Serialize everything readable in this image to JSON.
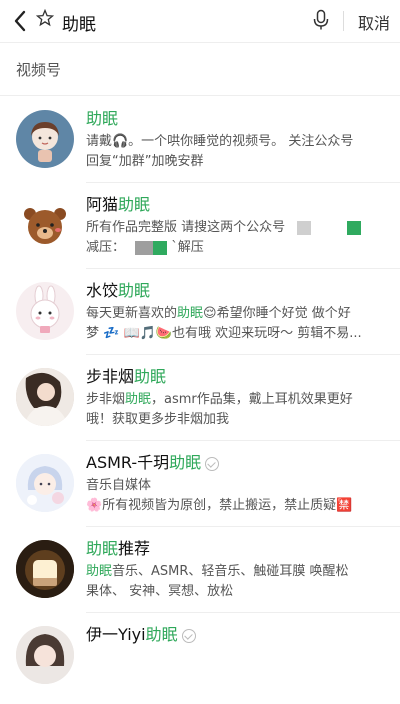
{
  "search": {
    "query": "助眠",
    "cancel_label": "取消"
  },
  "section": {
    "title": "视频号"
  },
  "results": [
    {
      "title_plain": "",
      "title_kw": "助眠",
      "desc1": "请戴🎧。一个哄你睡觉的视频号。 关注公众号",
      "desc2": "回复“加群”加晚安群",
      "avatar_bg": "#5f86a6"
    },
    {
      "title_plain": "阿猫",
      "title_kw": "助眠",
      "desc1": "所有作品完整版 请搜这两个公众号",
      "desc2": "减压：",
      "desc2_tail": "`解压",
      "avatar_bg": "#ffffff"
    },
    {
      "title_plain": "水饺",
      "title_kw": "助眠",
      "desc1_a": "每天更新喜欢的",
      "desc1_kw": "助眠",
      "desc1_b": "😌希望你睡个好觉 做个好",
      "desc2": "梦 💤 📖🎵🍉也有哦 欢迎来玩呀～ 剪辑不易...",
      "avatar_bg": "#f7eef0"
    },
    {
      "title_plain": "步非烟",
      "title_kw": "助眠",
      "desc1_a": "步非烟",
      "desc1_kw": "助眠",
      "desc1_b": "，asmr作品集，戴上耳机效果更好",
      "desc2": "哦！获取更多步非烟加我",
      "avatar_bg": "#d9cfc8"
    },
    {
      "title_plain": "ASMR-千玥",
      "title_kw": "助眠",
      "desc1": "音乐自媒体",
      "desc2": "🌸所有视频皆为原创，禁止搬运，禁止质疑🈲",
      "avatar_bg": "#e8eef7"
    },
    {
      "title_plain": "",
      "title_kw": "助眠",
      "title_suffix": "推荐",
      "desc1_kw": "助眠",
      "desc1_b": "音乐、ASMR、轻音乐、触碰耳膜 唤醒松",
      "desc2": "果体、 安神、冥想、放松",
      "avatar_bg": "#3b2a1c"
    },
    {
      "title_plain": "伊一Yiyi",
      "title_kw": "助眠",
      "avatar_bg": "#ece7e4"
    }
  ],
  "icons": {
    "back": "back-arrow-icon",
    "star": "star-icon",
    "mic": "microphone-icon",
    "verified": "verified-icon"
  },
  "colors": {
    "keyword_green": "#2fa85a",
    "divider": "#eeeeee"
  }
}
